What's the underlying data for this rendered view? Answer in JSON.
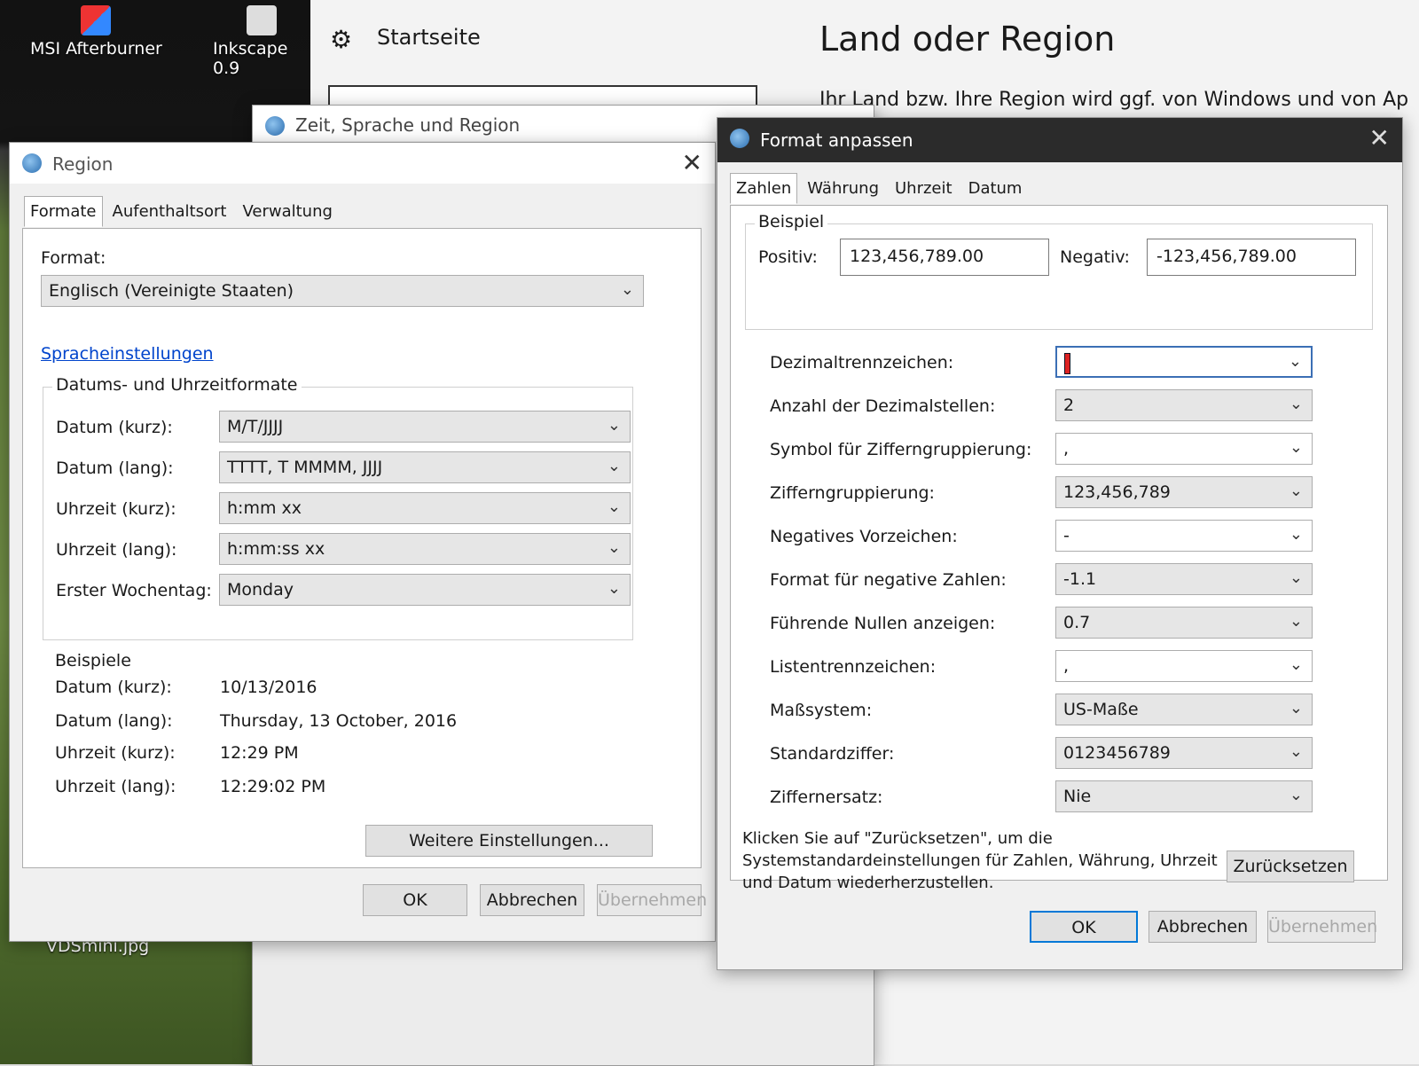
{
  "desktop": {
    "icons": [
      {
        "label": "MSI Afterburner",
        "icon": "msi-afterburner-icon"
      },
      {
        "label": "Inkscape 0.9",
        "icon": "inkscape-icon"
      },
      {
        "label": "VDSmini.jpg",
        "icon": "image-file-icon"
      }
    ]
  },
  "settings_app": {
    "nav_home": "Startseite",
    "page_title": "Land oder Region",
    "description": "Ihr Land bzw. Ihre Region wird ggf. von Windows und von Ap"
  },
  "zeit_window": {
    "title": "Zeit, Sprache und Region"
  },
  "region_window": {
    "title": "Region",
    "tabs": [
      "Formate",
      "Aufenthaltsort",
      "Verwaltung"
    ],
    "format_label": "Format:",
    "format_value": "Englisch (Vereinigte Staaten)",
    "language_link": "Spracheinstellungen",
    "datetime_group": "Datums- und Uhrzeitformate",
    "rows": [
      {
        "label": "Datum (kurz):",
        "value": "M/T/JJJJ"
      },
      {
        "label": "Datum (lang):",
        "value": "TTTT, T MMMM, JJJJ"
      },
      {
        "label": "Uhrzeit (kurz):",
        "value": "h:mm xx"
      },
      {
        "label": "Uhrzeit (lang):",
        "value": "h:mm:ss xx"
      },
      {
        "label": "Erster Wochentag:",
        "value": "Monday"
      }
    ],
    "examples_title": "Beispiele",
    "examples": [
      {
        "label": "Datum (kurz):",
        "value": "10/13/2016"
      },
      {
        "label": "Datum (lang):",
        "value": "Thursday, 13 October, 2016"
      },
      {
        "label": "Uhrzeit (kurz):",
        "value": "12:29 PM"
      },
      {
        "label": "Uhrzeit (lang):",
        "value": "12:29:02 PM"
      }
    ],
    "more_settings": "Weitere Einstellungen...",
    "ok": "OK",
    "cancel": "Abbrechen",
    "apply": "Übernehmen"
  },
  "format_window": {
    "title": "Format anpassen",
    "tabs": [
      "Zahlen",
      "Währung",
      "Uhrzeit",
      "Datum"
    ],
    "example_group": "Beispiel",
    "positive_label": "Positiv:",
    "positive_value": "123,456,789.00",
    "negative_label": "Negativ:",
    "negative_value": "-123,456,789.00",
    "rows": [
      {
        "label": "Dezimaltrennzeichen:",
        "value": ""
      },
      {
        "label": "Anzahl der Dezimalstellen:",
        "value": "2"
      },
      {
        "label": "Symbol für Zifferngruppierung:",
        "value": ","
      },
      {
        "label": "Zifferngruppierung:",
        "value": "123,456,789"
      },
      {
        "label": "Negatives Vorzeichen:",
        "value": "-"
      },
      {
        "label": "Format für negative Zahlen:",
        "value": "-1.1"
      },
      {
        "label": "Führende Nullen anzeigen:",
        "value": "0.7"
      },
      {
        "label": "Listentrennzeichen:",
        "value": ","
      },
      {
        "label": "Maßsystem:",
        "value": "US-Maße"
      },
      {
        "label": "Standardziffer:",
        "value": "0123456789"
      },
      {
        "label": "Ziffernersatz:",
        "value": "Nie"
      }
    ],
    "reset_text": "Klicken Sie auf \"Zurücksetzen\", um die Systemstandardeinstellungen für Zahlen, Währung, Uhrzeit und Datum wiederherzustellen.",
    "reset_button": "Zurücksetzen",
    "ok": "OK",
    "cancel": "Abbrechen",
    "apply": "Übernehmen"
  }
}
